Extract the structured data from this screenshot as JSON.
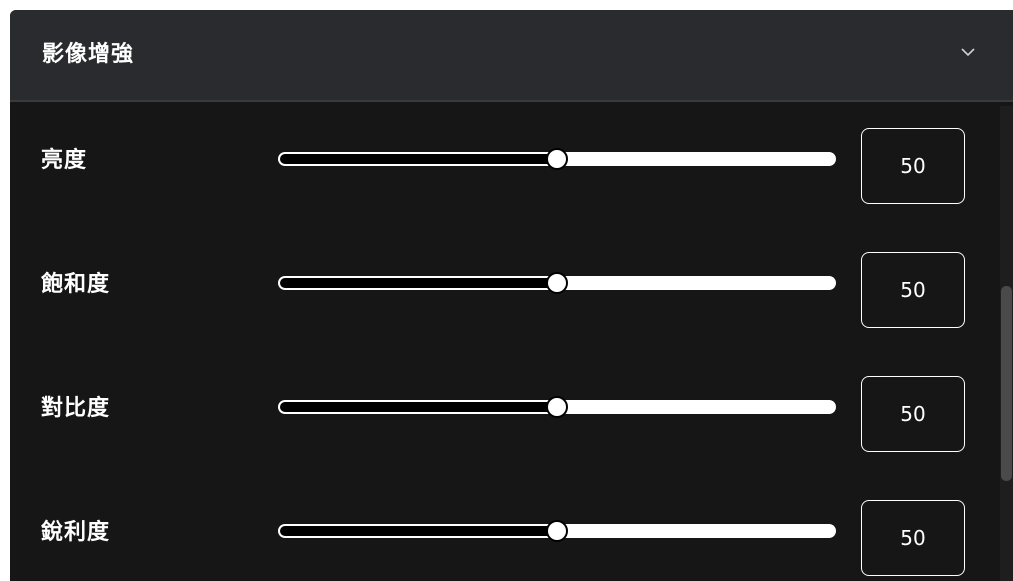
{
  "panel": {
    "title": "影像增強",
    "chevron_icon": "chevron-down-icon"
  },
  "sliders": [
    {
      "label": "亮度",
      "value": "50",
      "level": 50
    },
    {
      "label": "飽和度",
      "value": "50",
      "level": 50
    },
    {
      "label": "對比度",
      "value": "50",
      "level": 50
    },
    {
      "label": "銳利度",
      "value": "50",
      "level": 50
    }
  ],
  "colors": {
    "panel_bg": "#161616",
    "header_bg": "#2a2b2e",
    "text": "#ffffff",
    "track_filled": "#000000",
    "track_empty": "#ffffff"
  }
}
